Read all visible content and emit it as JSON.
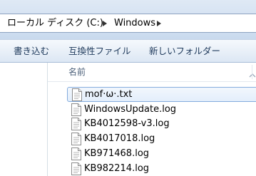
{
  "address_bar": {
    "crumbs": [
      "ローカル ディスク (C:)",
      "Windows"
    ]
  },
  "command_bar": {
    "burn_label": "書き込む",
    "compat_files_label": "互換性ファイル",
    "new_folder_label": "新しいフォルダー"
  },
  "file_list": {
    "column_name_label": "名前",
    "files": [
      {
        "name": "mof·ω·.txt",
        "selected": true
      },
      {
        "name": "WindowsUpdate.log",
        "selected": false
      },
      {
        "name": "KB4012598-v3.log",
        "selected": false
      },
      {
        "name": "KB4017018.log",
        "selected": false
      },
      {
        "name": "KB971468.log",
        "selected": false
      },
      {
        "name": "KB982214.log",
        "selected": false
      }
    ]
  },
  "colors": {
    "toolbar_text": "#1e395b",
    "selection_border": "#84acdd"
  },
  "icons": [
    "chevron-right-icon",
    "chevron-right-icon",
    "chevron-up-icon",
    "text-file-icon"
  ]
}
